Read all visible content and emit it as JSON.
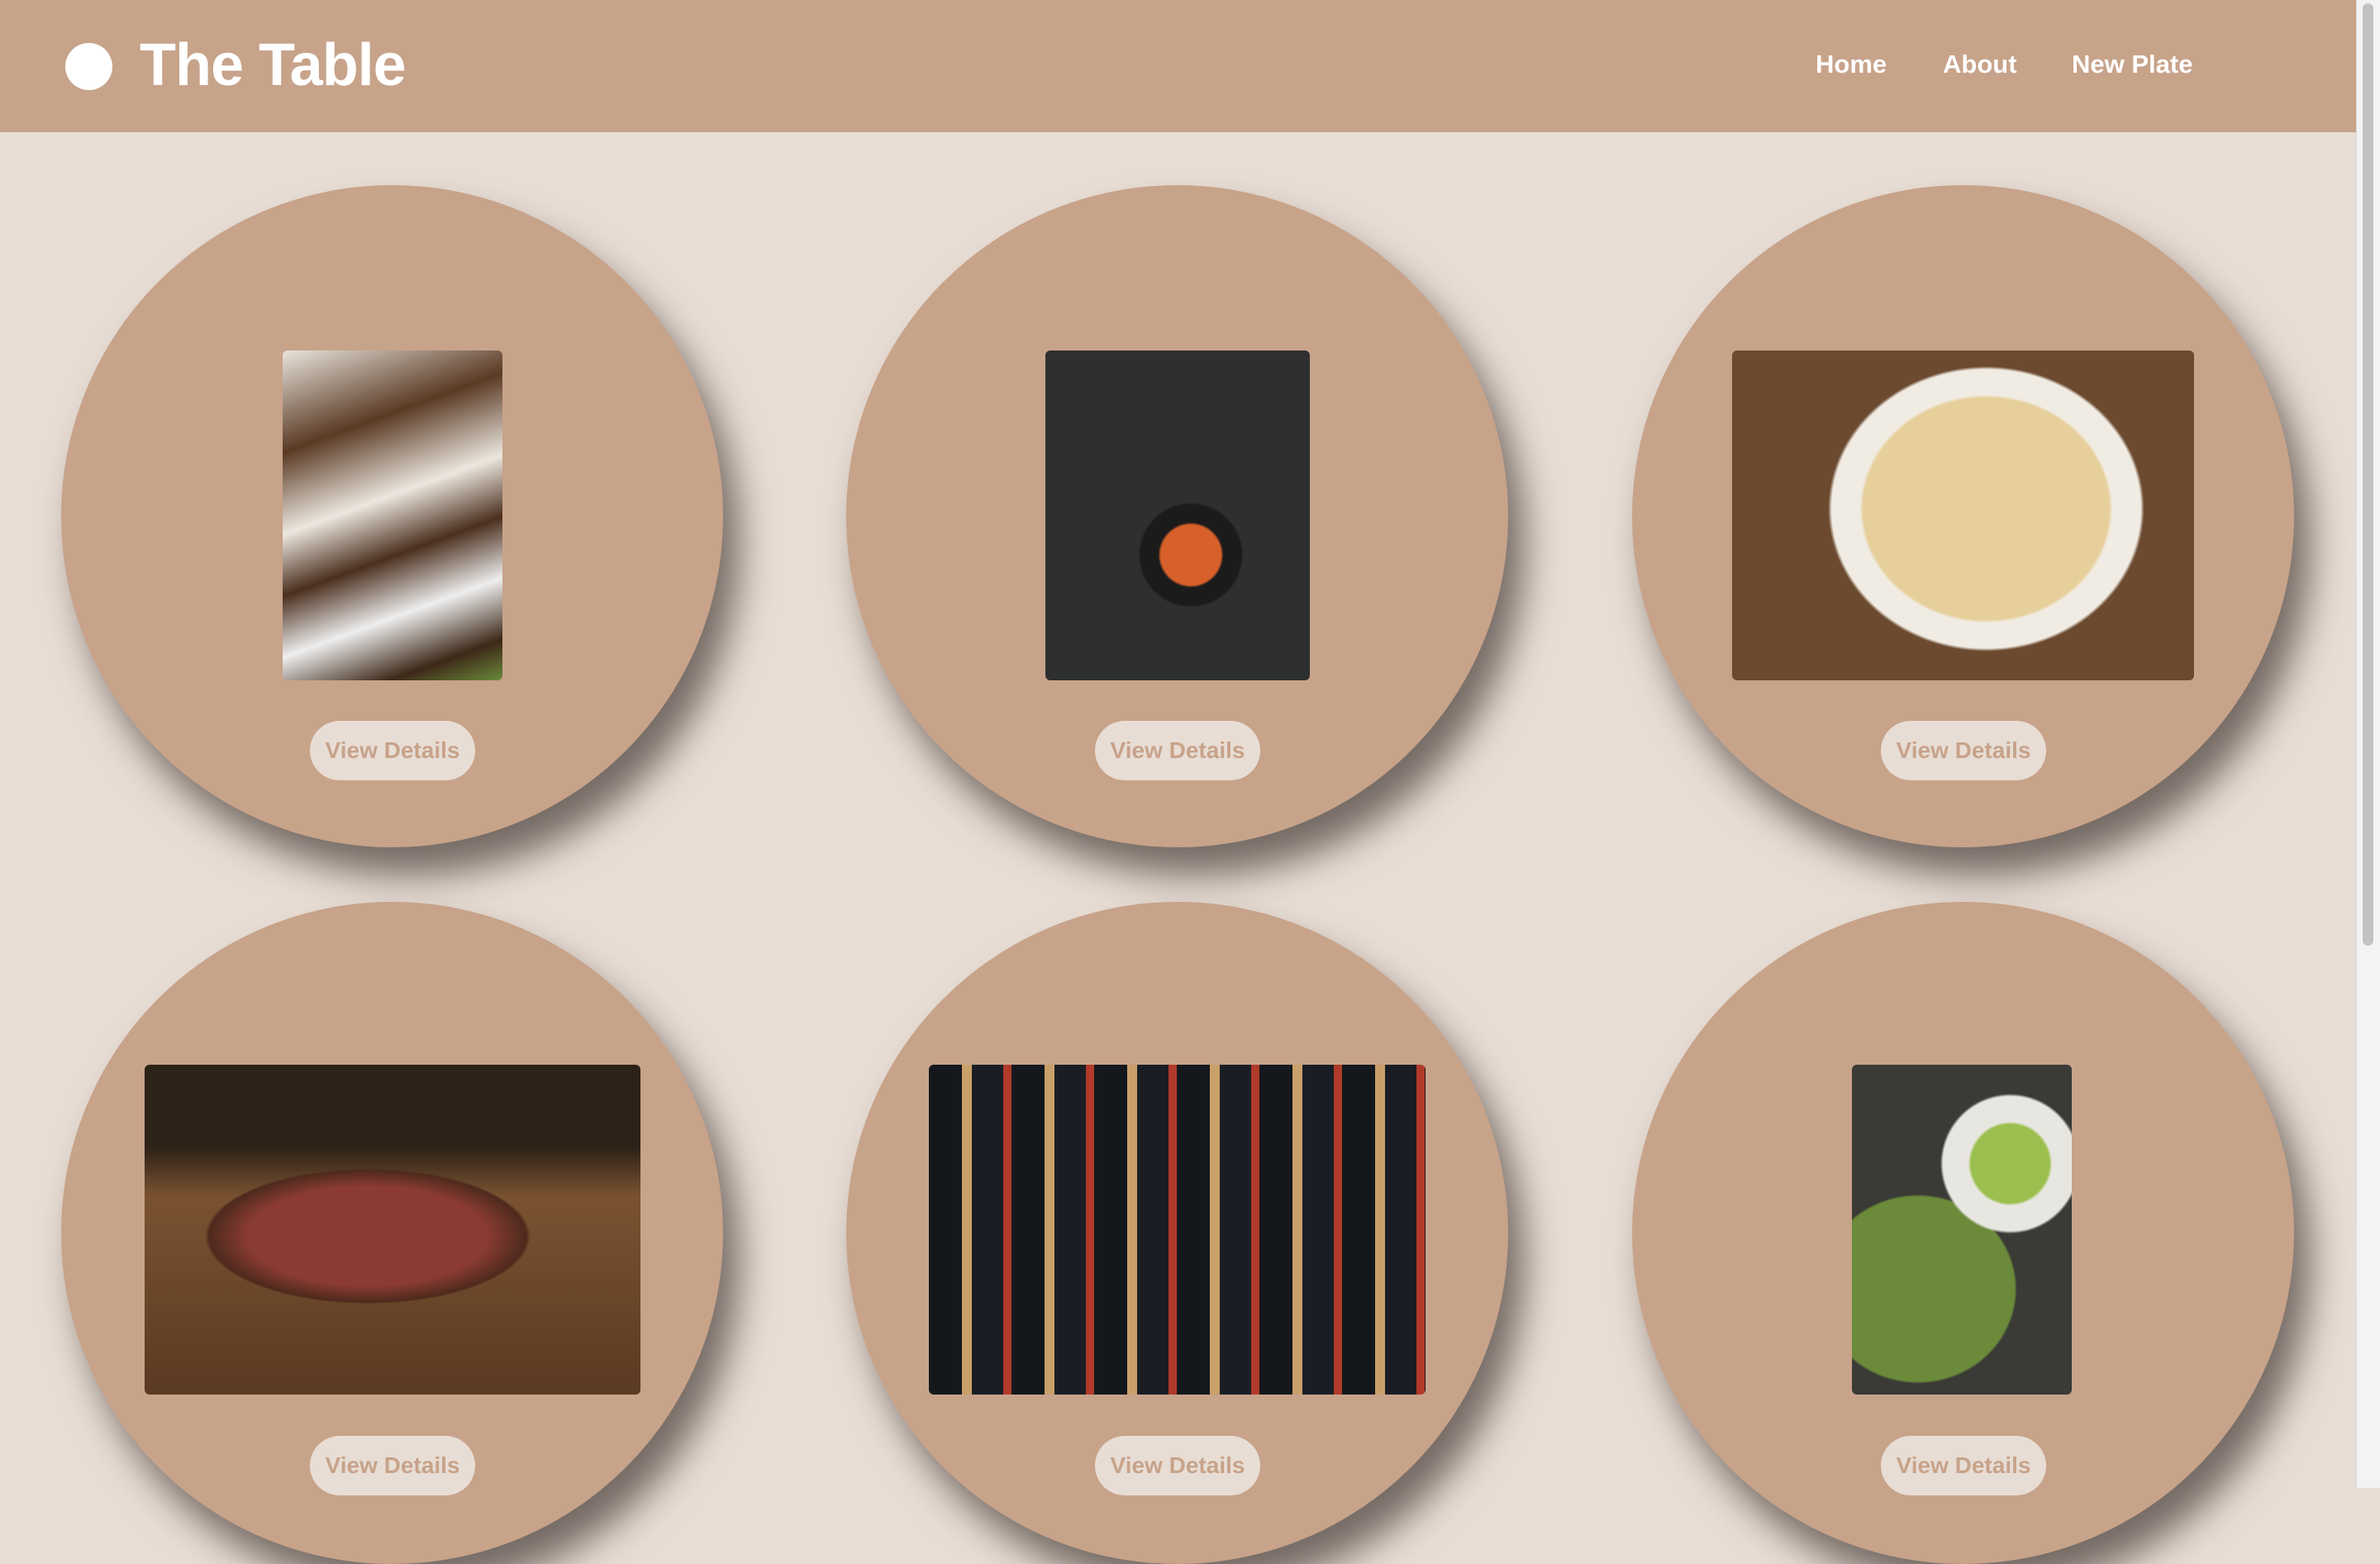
{
  "header": {
    "title": "The Table",
    "nav": [
      "Home",
      "About",
      "New Plate"
    ]
  },
  "colors": {
    "brand": "#c7a38a",
    "background": "#e8ddd4"
  },
  "plates": [
    {
      "image": "tacos",
      "button": "View Details"
    },
    {
      "image": "shakshuka",
      "button": "View Details"
    },
    {
      "image": "hummus",
      "button": "View Details"
    },
    {
      "image": "steak",
      "button": "View Details"
    },
    {
      "image": "wine-bottles",
      "button": "View Details"
    },
    {
      "image": "green-soup",
      "button": "View Details"
    }
  ]
}
